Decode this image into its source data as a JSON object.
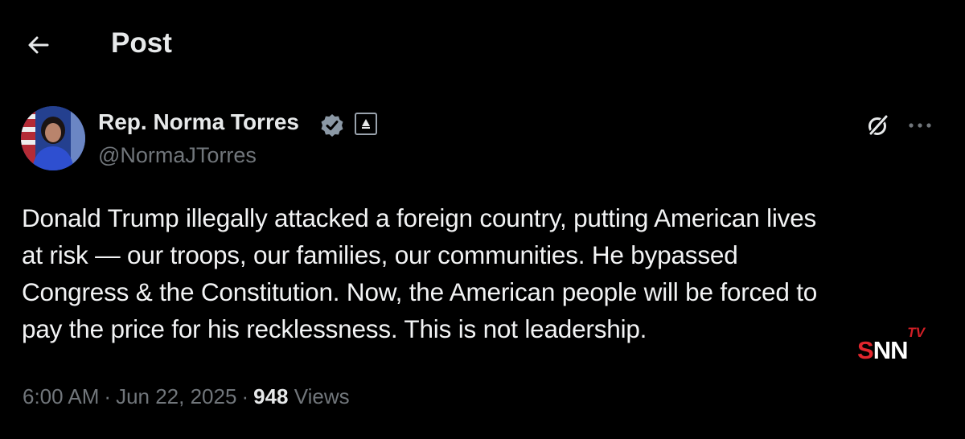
{
  "header": {
    "back_icon": "arrow-left-icon",
    "title": "Post"
  },
  "author": {
    "name": "Rep. Norma Torres",
    "handle": "@NormaJTorres",
    "verified_icon": "verified-badge-icon",
    "verified_color": "#8b98a5",
    "affiliation_icon": "government-affiliation-icon"
  },
  "actions": {
    "grok_icon": "grok-icon",
    "more_icon": "more-horizontal-icon"
  },
  "post": {
    "line1": "Donald Trump illegally attacked a foreign country,  putting American lives",
    "line2": "at risk — our troops, our families, our communities. He bypassed",
    "line3": "Congress & the Constitution. Now, the American people will be forced to",
    "line4": "pay the price for his recklessness. This is not leadership."
  },
  "meta": {
    "time": "6:00 AM",
    "date": "Jun 22, 2025",
    "views_count": "948",
    "views_label": "Views",
    "separator": "·"
  },
  "watermark": {
    "s": "S",
    "nn": "NN",
    "tv": "TV",
    "s_color": "#e0262d"
  }
}
